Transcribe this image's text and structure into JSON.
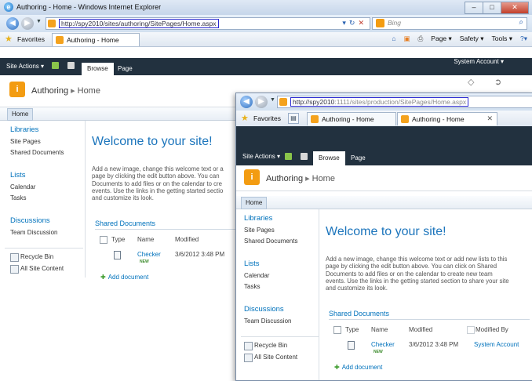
{
  "window1": {
    "title": "Authoring - Home - Windows Internet Explorer",
    "controls": {
      "minimize": "–",
      "maximize": "□",
      "close": "✕"
    },
    "url_prefix": "http://",
    "url_host": "spy2010",
    "url_path": "/sites/authoring/SitePages/Home.aspx",
    "search_placeholder": "Bing",
    "favorites_label": "Favorites",
    "tab_title": "Authoring - Home",
    "commands": [
      "Page ▾",
      "Safety ▾",
      "Tools ▾",
      "?▾"
    ],
    "site_actions": "Site Actions ▾",
    "ribbon_browse": "Browse",
    "ribbon_page": "Page",
    "system_account": "System Account ▾",
    "site_title": "Authoring",
    "breadcrumb": "Home",
    "top_nav_home": "Home",
    "quick_launch": {
      "libraries": "Libraries",
      "site_pages": "Site Pages",
      "shared_documents": "Shared Documents",
      "lists": "Lists",
      "calendar": "Calendar",
      "tasks": "Tasks",
      "discussions": "Discussions",
      "team_discussion": "Team Discussion",
      "recycle_bin": "Recycle Bin",
      "all_site_content": "All Site Content"
    },
    "welcome": "Welcome to your site!",
    "description_lines": [
      "Add a new image, change this welcome text or a",
      "page by clicking the edit button above. You can",
      "Documents to add files or on the calendar to cre",
      "events. Use the links in the getting started sectio",
      "and customize its look."
    ],
    "shared_docs_title": "Shared Documents",
    "columns": {
      "type": "Type",
      "name": "Name",
      "modified": "Modified"
    },
    "row": {
      "name": "Checker",
      "new": "NEW",
      "modified": "3/6/2012 3:48 PM"
    },
    "add_document": "Add document"
  },
  "window2": {
    "url_prefix": "http://",
    "url_host": "spy2010",
    "url_path": ":1111/sites/production/SitePages/Home.aspx",
    "favorites_label": "Favorites",
    "tab1_title": "Authoring - Home",
    "tab2_title": "Authoring - Home",
    "tab_close": "✕",
    "site_actions": "Site Actions ▾",
    "ribbon_browse": "Browse",
    "ribbon_page": "Page",
    "site_title": "Authoring",
    "breadcrumb": "Home",
    "top_nav_home": "Home",
    "quick_launch": {
      "libraries": "Libraries",
      "site_pages": "Site Pages",
      "shared_documents": "Shared Documents",
      "lists": "Lists",
      "calendar": "Calendar",
      "tasks": "Tasks",
      "discussions": "Discussions",
      "team_discussion": "Team Discussion",
      "recycle_bin": "Recycle Bin",
      "all_site_content": "All Site Content"
    },
    "welcome": "Welcome to your site!",
    "description_lines": [
      "Add a new image, change this welcome text or add new lists to this",
      "page by clicking the edit button above. You can click on Shared",
      "Documents to add files or on the calendar to create new team",
      "events. Use the links in the getting started section to share your site",
      "and customize its look."
    ],
    "shared_docs_title": "Shared Documents",
    "columns": {
      "type": "Type",
      "name": "Name",
      "modified": "Modified",
      "modified_by": "Modified By"
    },
    "row": {
      "name": "Checker",
      "new": "NEW",
      "modified": "3/6/2012 3:48 PM",
      "modified_by": "System Account"
    },
    "add_document": "Add document"
  },
  "icons": {
    "ie": "e",
    "back": "◀",
    "forward": "▶",
    "favorites_star": "★",
    "home": "⌂",
    "rss": "▣",
    "print": "⎙",
    "search": "⌕",
    "refresh": "↻",
    "stop": "✕",
    "folder": "▤",
    "document": "▯",
    "plus": "✚",
    "tag": "◇",
    "share": "➲"
  }
}
